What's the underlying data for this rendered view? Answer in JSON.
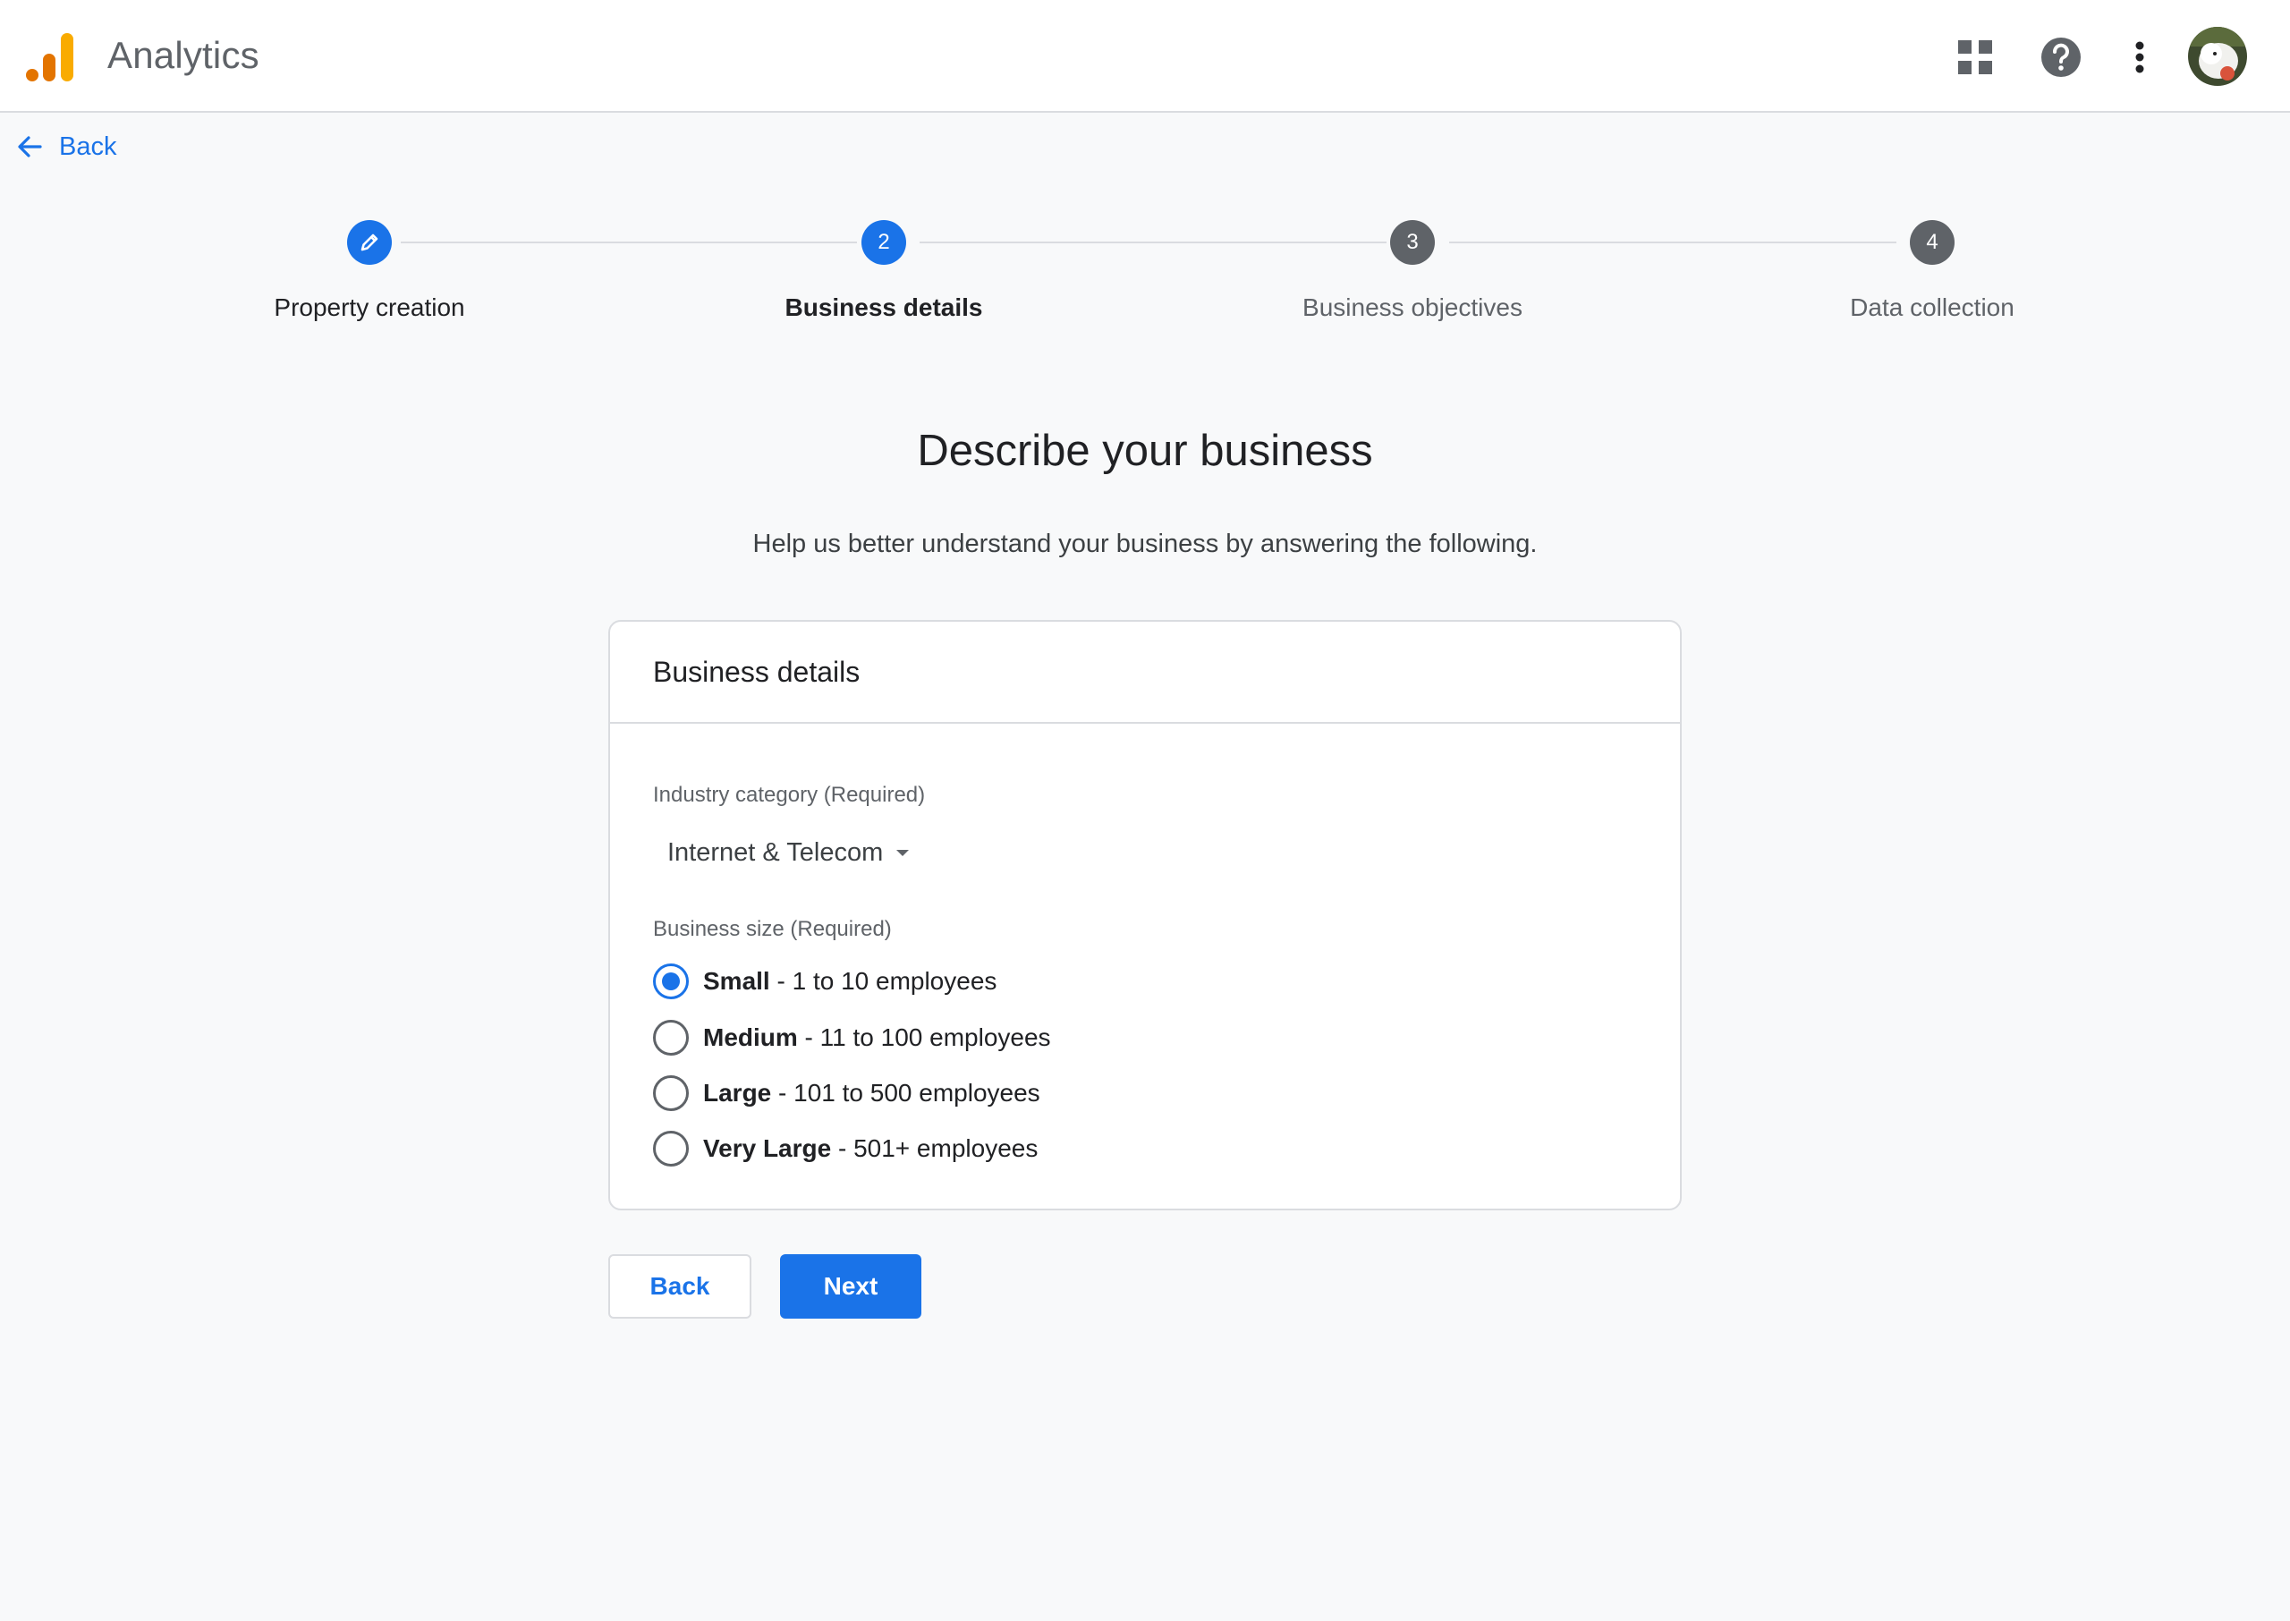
{
  "header": {
    "app_title": "Analytics"
  },
  "nav": {
    "back_label": "Back"
  },
  "stepper": {
    "steps": [
      {
        "number": "",
        "label": "Property creation",
        "state": "completed",
        "icon": "edit-icon"
      },
      {
        "number": "2",
        "label": "Business details",
        "state": "current"
      },
      {
        "number": "3",
        "label": "Business objectives",
        "state": "pending"
      },
      {
        "number": "4",
        "label": "Data collection",
        "state": "pending"
      }
    ]
  },
  "page": {
    "title": "Describe your business",
    "subtitle": "Help us better understand your business by answering the following."
  },
  "card": {
    "title": "Business details",
    "industry": {
      "label": "Industry category (Required)",
      "selected": "Internet & Telecom"
    },
    "size": {
      "label": "Business size (Required)",
      "options": [
        {
          "name": "Small",
          "detail": " - 1 to 10 employees",
          "checked": true
        },
        {
          "name": "Medium",
          "detail": " - 11 to 100 employees",
          "checked": false
        },
        {
          "name": "Large",
          "detail": " - 101 to 500 employees",
          "checked": false
        },
        {
          "name": "Very Large",
          "detail": " - 501+ employees",
          "checked": false
        }
      ]
    }
  },
  "buttons": {
    "back": "Back",
    "next": "Next"
  },
  "colors": {
    "primary": "#1a73e8",
    "pending_step": "#5f6368",
    "background": "#f8f9fa"
  }
}
